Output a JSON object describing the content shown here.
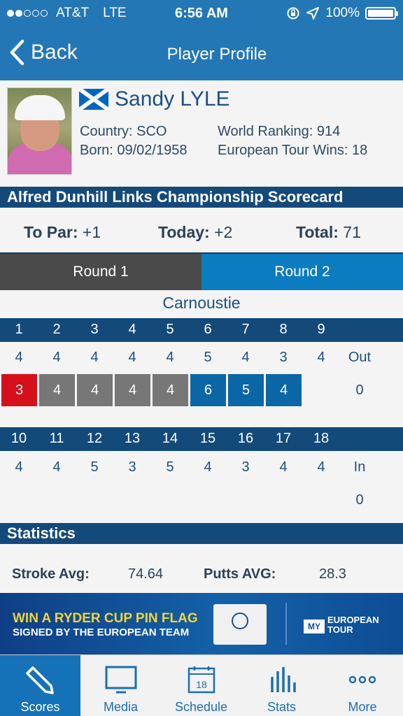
{
  "status_bar": {
    "carrier": "AT&T",
    "network": "LTE",
    "time": "6:56 AM",
    "battery": "100%"
  },
  "nav": {
    "back_label": "Back",
    "title": "Player Profile"
  },
  "player": {
    "name": "Sandy LYLE",
    "country": "Country: SCO",
    "born": "Born: 09/02/1958",
    "world_ranking": "World Ranking: 914",
    "tour_wins": "European Tour Wins: 18"
  },
  "scorecard": {
    "title": "Alfred Dunhill Links Championship Scorecard",
    "to_par_label": "To Par:",
    "to_par": "+1",
    "today_label": "Today:",
    "today": "+2",
    "total_label": "Total:",
    "total": "71",
    "rounds": [
      "Round 1",
      "Round 2"
    ],
    "course": "Carnoustie",
    "front": {
      "holes": [
        "1",
        "2",
        "3",
        "4",
        "5",
        "6",
        "7",
        "8",
        "9"
      ],
      "par": [
        "4",
        "4",
        "4",
        "4",
        "4",
        "5",
        "4",
        "3",
        "4"
      ],
      "par_total_label": "Out",
      "scores": [
        "3",
        "4",
        "4",
        "4",
        "4",
        "6",
        "5",
        "4"
      ],
      "score_colors": [
        "#d6101b",
        "#777777",
        "#777777",
        "#777777",
        "#777777",
        "#0b66a6",
        "#0b66a6",
        "#0b66a6"
      ],
      "total": "0"
    },
    "back": {
      "holes": [
        "10",
        "11",
        "12",
        "13",
        "14",
        "15",
        "16",
        "17",
        "18"
      ],
      "par": [
        "4",
        "4",
        "5",
        "3",
        "5",
        "4",
        "3",
        "4",
        "4"
      ],
      "par_total_label": "In",
      "total": "0"
    }
  },
  "statistics": {
    "title": "Statistics",
    "stroke_avg_label": "Stroke Avg:",
    "stroke_avg": "74.64",
    "putts_avg_label": "Putts AVG:",
    "putts_avg": "28.3"
  },
  "banner": {
    "line1": "WIN A RYDER CUP PIN FLAG",
    "line2": "SIGNED BY THE EUROPEAN TEAM",
    "my": "MY",
    "tour_line1": "EUROPEAN",
    "tour_line2": "TOUR"
  },
  "tabbar": [
    {
      "label": "Scores",
      "icon": "pencil-icon"
    },
    {
      "label": "Media",
      "icon": "monitor-icon"
    },
    {
      "label": "Schedule",
      "icon": "calendar-icon",
      "badge": "18"
    },
    {
      "label": "Stats",
      "icon": "bar-chart-icon"
    },
    {
      "label": "More",
      "icon": "more-dots-icon"
    }
  ]
}
